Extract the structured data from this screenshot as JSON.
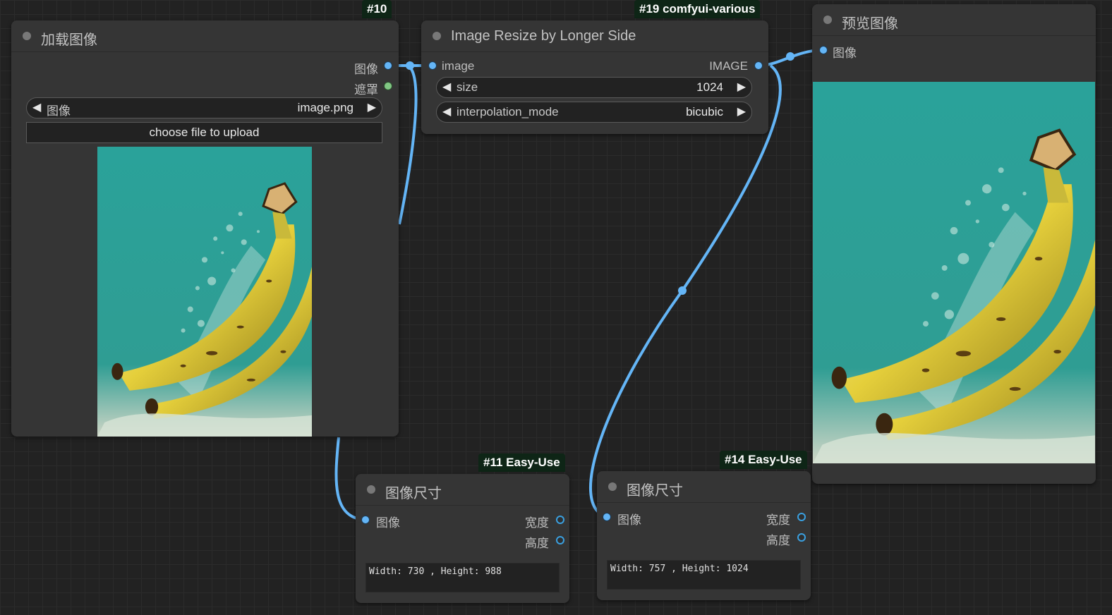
{
  "colors": {
    "canvas": "#222222",
    "node_body": "#353535",
    "badge_bg": "#0e2516",
    "link_image": "#64b5f6",
    "port_mask": "#81c784",
    "image_teal": "#2aa29a",
    "banana_yellow": "#e5cf3b"
  },
  "nodes": {
    "load_image": {
      "badge": "#10",
      "title": "加载图像",
      "outputs": [
        "图像",
        "遮罩"
      ],
      "widget": {
        "label": "图像",
        "value": "image.png"
      },
      "upload_label": "choose file to upload"
    },
    "resize": {
      "badge": "#19 comfyui-various",
      "title": "Image Resize by Longer Side",
      "input": "image",
      "output": "IMAGE",
      "widgets": [
        {
          "label": "size",
          "value": "1024"
        },
        {
          "label": "interpolation_mode",
          "value": "bicubic"
        }
      ]
    },
    "preview": {
      "title": "预览图像",
      "input": "图像"
    },
    "size_a": {
      "badge": "#11 Easy-Use",
      "title": "图像尺寸",
      "input": "图像",
      "outputs": [
        "宽度",
        "高度"
      ],
      "text": "Width: 730 , Height: 988"
    },
    "size_b": {
      "badge": "#14 Easy-Use",
      "title": "图像尺寸",
      "input": "图像",
      "outputs": [
        "宽度",
        "高度"
      ],
      "text": "Width: 757 , Height: 1024"
    }
  }
}
